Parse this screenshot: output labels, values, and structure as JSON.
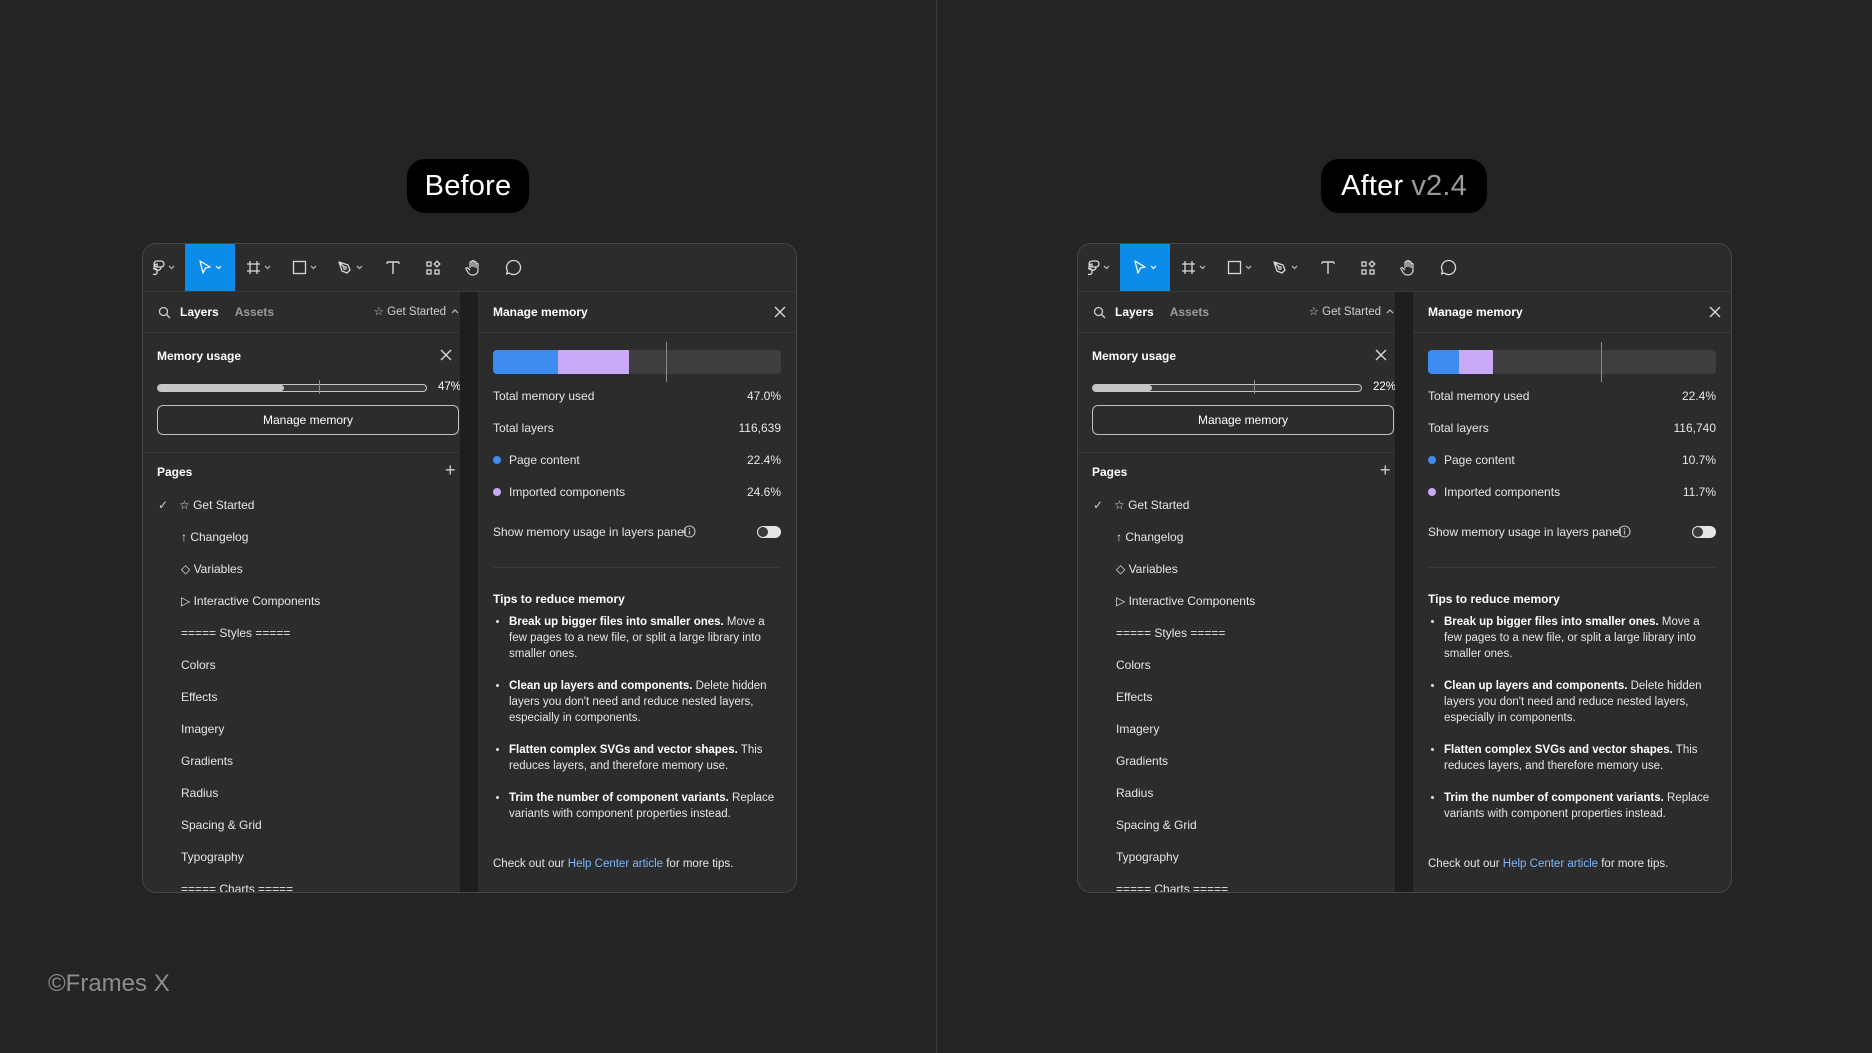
{
  "labels": {
    "before": "Before",
    "after": "After",
    "after_version": "v2.4"
  },
  "copyright": "©Frames X",
  "colors": {
    "background": "#252424",
    "accent": "#0c8ce9",
    "page_content": "#3d8cf0",
    "imported_components": "#c9a8f5"
  },
  "toolbar_icons": [
    "figma-logo-icon",
    "move-icon",
    "frame-icon",
    "rectangle-icon",
    "pen-icon",
    "text-icon",
    "components-icon",
    "hand-icon",
    "comment-icon"
  ],
  "panels": [
    {
      "layers_tab": "Layers",
      "assets_tab": "Assets",
      "page_selector": "☆ Get Started",
      "memory_usage_title": "Memory usage",
      "memory_percent_label": "47%",
      "memory_fraction": 0.47,
      "manage_memory_button": "Manage memory",
      "pages_title": "Pages",
      "pages": [
        "☆ Get Started",
        "↑ Changelog",
        "◇ Variables",
        "▷ Interactive Components",
        "===== Styles =====",
        "Colors",
        "Effects",
        "Imagery",
        "Gradients",
        "Radius",
        "Spacing & Grid",
        "Typography",
        "===== Charts ====="
      ],
      "manage_memory_title": "Manage memory",
      "page_content_fraction": 0.224,
      "imported_components_fraction": 0.246,
      "total_memory_label": "Total memory used",
      "total_memory_value": "47.0%",
      "total_layers_label": "Total layers",
      "total_layers_value": "116,639",
      "page_content_label": "Page content",
      "page_content_value": "22.4%",
      "imported_label": "Imported components",
      "imported_value": "24.6%",
      "show_usage_label": "Show memory usage in layers panel",
      "tips_title": "Tips to reduce memory",
      "tips": [
        {
          "bold": "Break up bigger files into smaller ones.",
          "text": " Move a few pages to a new file, or split a large library into smaller ones."
        },
        {
          "bold": "Clean up layers and components.",
          "text": " Delete hidden layers you don't need and reduce nested layers, especially in components."
        },
        {
          "bold": "Flatten complex SVGs and vector shapes.",
          "text": " This reduces layers, and therefore memory use."
        },
        {
          "bold": "Trim the number of component variants.",
          "text": " Replace variants with component properties instead."
        }
      ],
      "footer_prefix": "Check out our ",
      "footer_link": "Help Center article",
      "footer_suffix": " for more tips."
    },
    {
      "layers_tab": "Layers",
      "assets_tab": "Assets",
      "page_selector": "☆ Get Started",
      "memory_usage_title": "Memory usage",
      "memory_percent_label": "22%",
      "memory_fraction": 0.22,
      "manage_memory_button": "Manage memory",
      "pages_title": "Pages",
      "pages": [
        "☆ Get Started",
        "↑ Changelog",
        "◇ Variables",
        "▷ Interactive Components",
        "===== Styles =====",
        "Colors",
        "Effects",
        "Imagery",
        "Gradients",
        "Radius",
        "Spacing & Grid",
        "Typography",
        "===== Charts ====="
      ],
      "manage_memory_title": "Manage memory",
      "page_content_fraction": 0.107,
      "imported_components_fraction": 0.117,
      "total_memory_label": "Total memory used",
      "total_memory_value": "22.4%",
      "total_layers_label": "Total layers",
      "total_layers_value": "116,740",
      "page_content_label": "Page content",
      "page_content_value": "10.7%",
      "imported_label": "Imported components",
      "imported_value": "11.7%",
      "show_usage_label": "Show memory usage in layers panel",
      "tips_title": "Tips to reduce memory",
      "tips": [
        {
          "bold": "Break up bigger files into smaller ones.",
          "text": " Move a few pages to a new file, or split a large library into smaller ones."
        },
        {
          "bold": "Clean up layers and components.",
          "text": " Delete hidden layers you don't need and reduce nested layers, especially in components."
        },
        {
          "bold": "Flatten complex SVGs and vector shapes.",
          "text": " This reduces layers, and therefore memory use."
        },
        {
          "bold": "Trim the number of component variants.",
          "text": " Replace variants with component properties instead."
        }
      ],
      "footer_prefix": "Check out our ",
      "footer_link": "Help Center article",
      "footer_suffix": " for more tips."
    }
  ]
}
